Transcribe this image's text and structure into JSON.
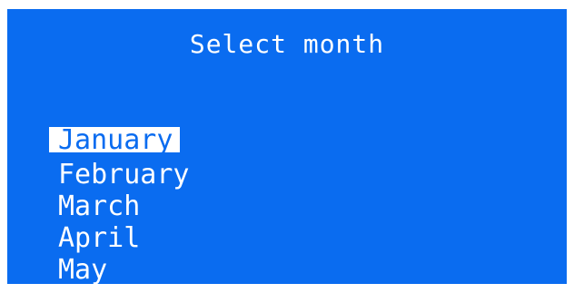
{
  "title": "Select month",
  "months": [
    {
      "label": "January",
      "selected": true
    },
    {
      "label": "February",
      "selected": false
    },
    {
      "label": "March",
      "selected": false
    },
    {
      "label": "April",
      "selected": false
    },
    {
      "label": "May",
      "selected": false
    }
  ],
  "colors": {
    "background": "#0a6cf0",
    "text": "#ffffff",
    "selected_text": "#0a6cf0",
    "selected_background": "#ffffff"
  }
}
